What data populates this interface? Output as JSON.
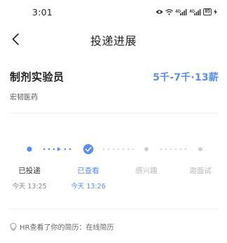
{
  "status_bar": {
    "time": "3:01",
    "battery": "85",
    "signal_1_label": "4G",
    "signal_2_label": "4G"
  },
  "nav": {
    "title": "投递进展",
    "back_icon": "chevron-left-icon"
  },
  "job": {
    "title": "制剂实验员",
    "salary": "5千-7千·13薪",
    "company": "宏韧医药"
  },
  "progress": {
    "steps": [
      {
        "label": "已投递",
        "time": "今天 13:25",
        "state": "done"
      },
      {
        "label": "已查看",
        "time": "今天 13:26",
        "state": "current"
      },
      {
        "label": "感兴趣",
        "time": "",
        "state": "pending"
      },
      {
        "label": "邀面试",
        "time": "",
        "state": "pending"
      }
    ]
  },
  "hr_hint": {
    "icon": "lightbulb-icon",
    "text": "HR查看了你的简历：在线简历"
  },
  "colors": {
    "accent": "#5b8def",
    "text_primary": "#222222",
    "text_secondary": "#888888",
    "pending": "#c8c8c8",
    "pending_text": "#bbbbbb",
    "done_text": "#333333"
  }
}
